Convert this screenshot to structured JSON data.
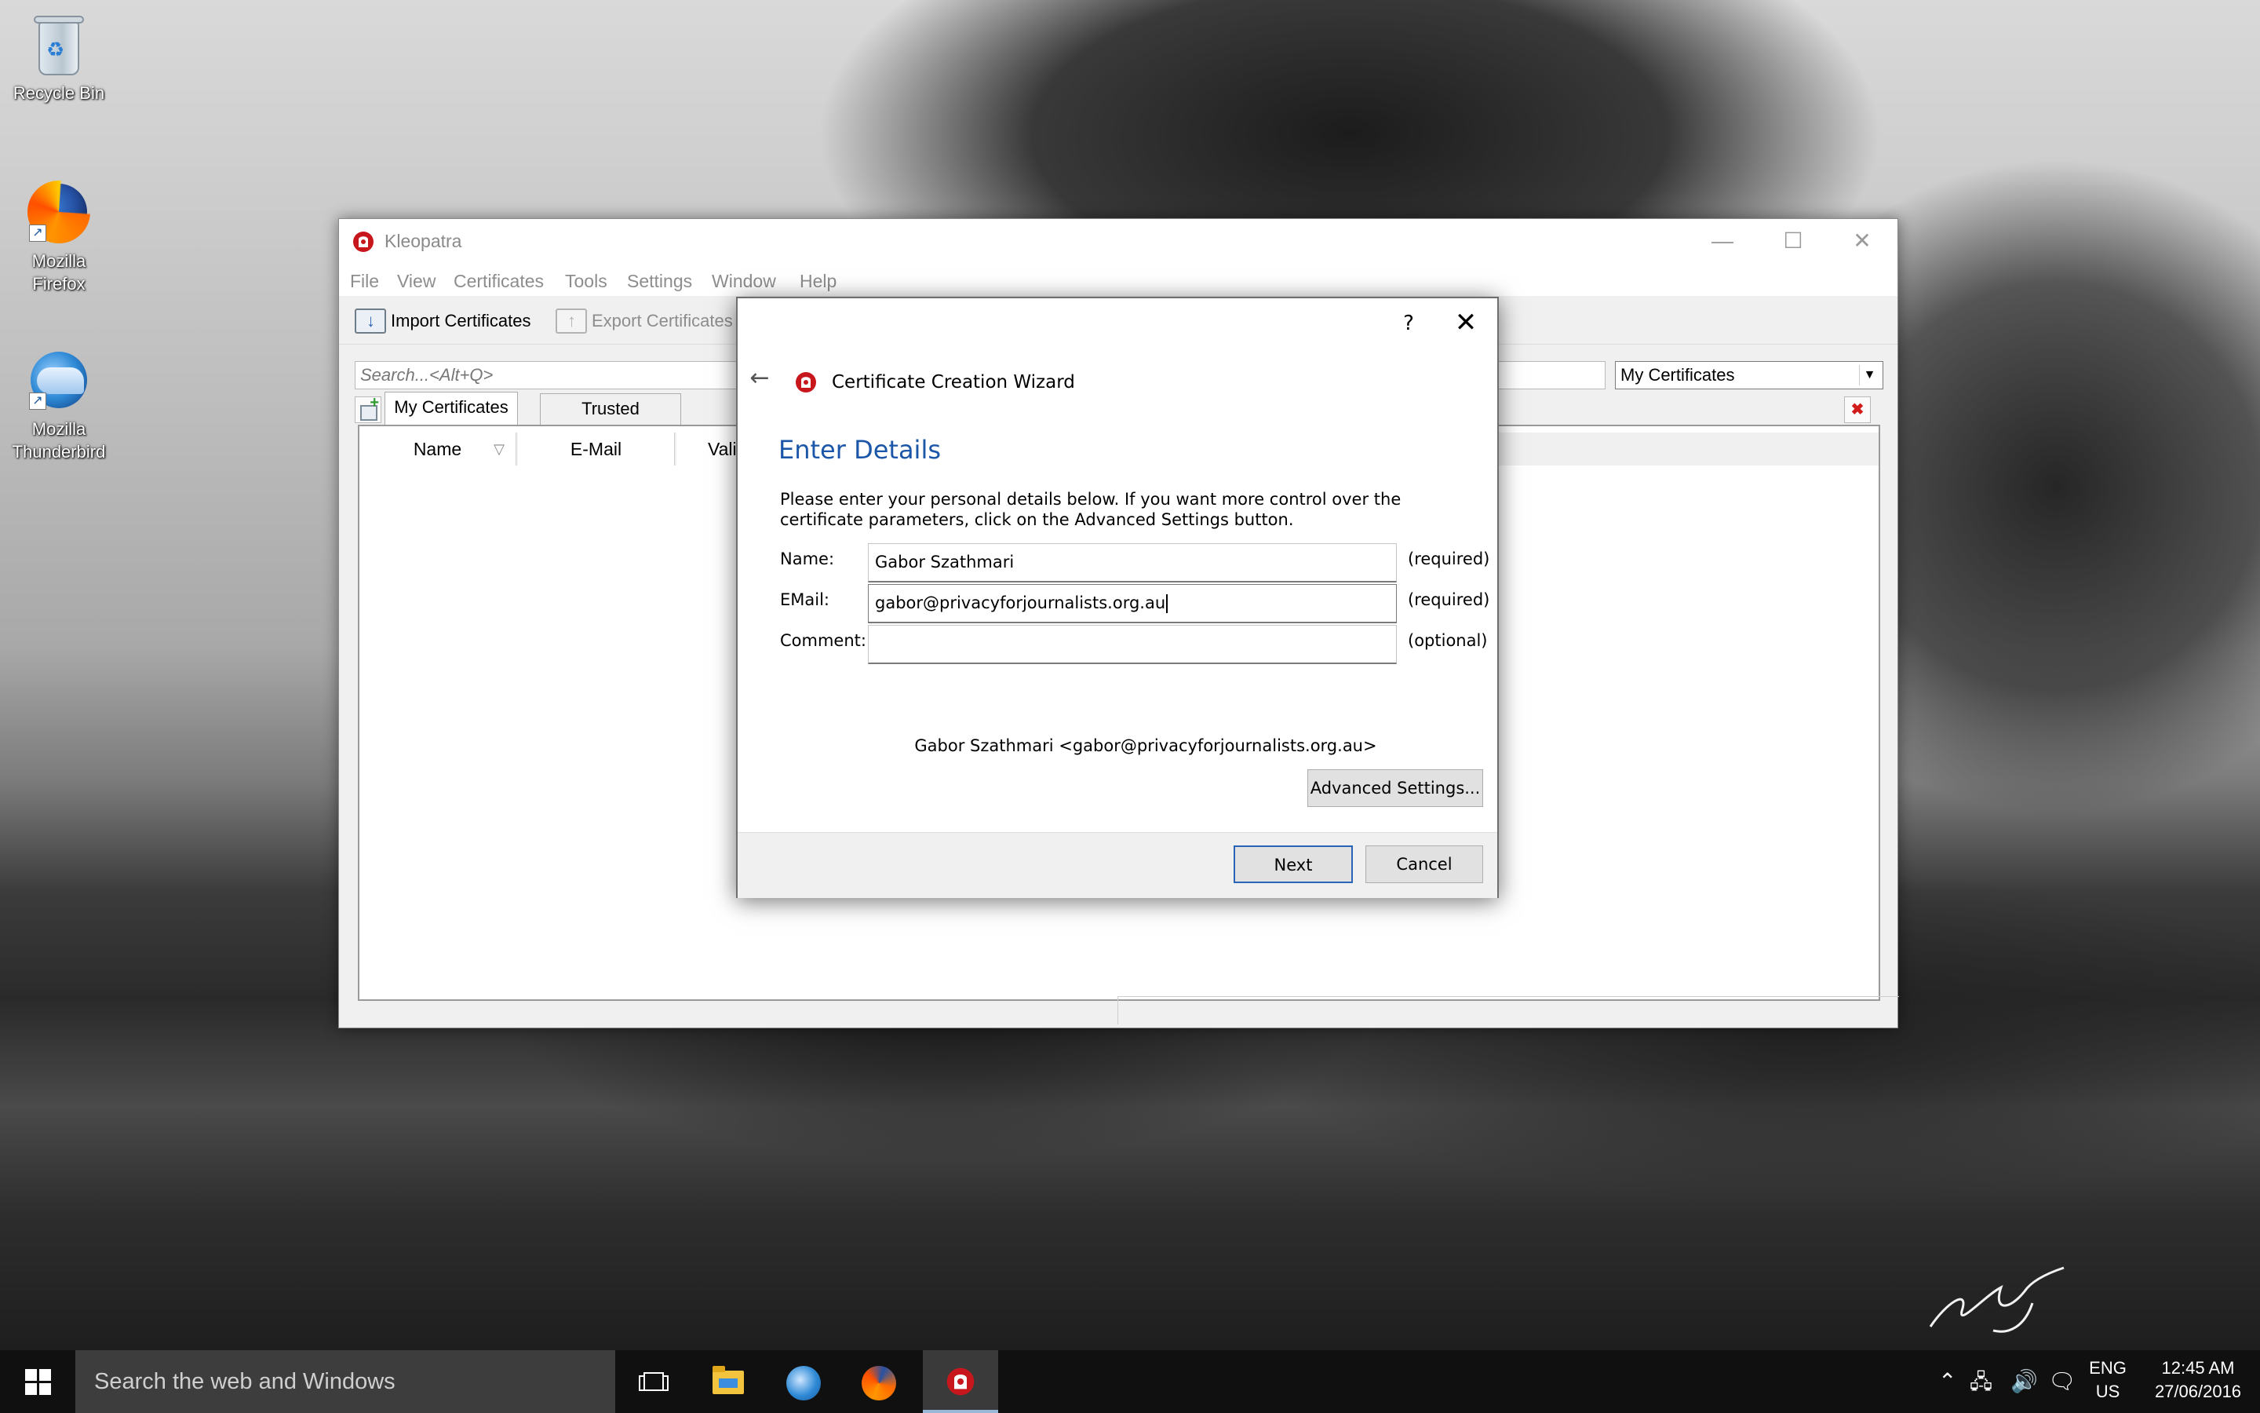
{
  "desktop": {
    "icons": [
      {
        "label": "Recycle Bin"
      },
      {
        "label": "Mozilla Firefox"
      },
      {
        "label": "Mozilla Thunderbird"
      }
    ]
  },
  "kleopatra": {
    "title": "Kleopatra",
    "menu": [
      "File",
      "View",
      "Certificates",
      "Tools",
      "Settings",
      "Window",
      "Help"
    ],
    "toolbar": {
      "import_label": "Import Certificates",
      "export_label": "Export Certificates"
    },
    "search_placeholder": "Search...<Alt+Q>",
    "filter_value": "My Certificates",
    "tabs": [
      "My Certificates",
      "Trusted Certificates"
    ],
    "columns": [
      "Name",
      "E-Mail",
      "Vali"
    ]
  },
  "wizard": {
    "help_glyph": "?",
    "window_title": "Certificate Creation Wizard",
    "heading": "Enter Details",
    "description": "Please enter your personal details below. If you want more control over the certificate parameters, click on the Advanced Settings button.",
    "fields": {
      "name": {
        "label": "Name:",
        "value": "Gabor Szathmari",
        "hint": "(required)"
      },
      "email": {
        "label": "EMail:",
        "value": "gabor@privacyforjournalists.org.au",
        "hint": "(required)"
      },
      "comment": {
        "label": "Comment:",
        "value": "",
        "hint": "(optional)"
      }
    },
    "preview": "Gabor Szathmari <gabor@privacyforjournalists.org.au>",
    "advanced_button": "Advanced Settings...",
    "next_button": "Next",
    "cancel_button": "Cancel"
  },
  "taskbar": {
    "search_placeholder": "Search the web and Windows",
    "language_line1": "ENG",
    "language_line2": "US",
    "time": "12:45 AM",
    "date": "27/06/2016"
  },
  "colors": {
    "accent": "#1b56a8",
    "default_button_border": "#2a64b8",
    "kleopatra_red": "#c8161d"
  },
  "icons": [
    "recycle-bin-icon",
    "firefox-icon",
    "thunderbird-icon",
    "kleopatra-icon",
    "back-arrow-icon",
    "close-icon",
    "help-icon",
    "windows-start-icon",
    "task-view-icon",
    "file-explorer-icon",
    "chevron-up-icon",
    "network-icon",
    "volume-icon",
    "notification-icon"
  ]
}
